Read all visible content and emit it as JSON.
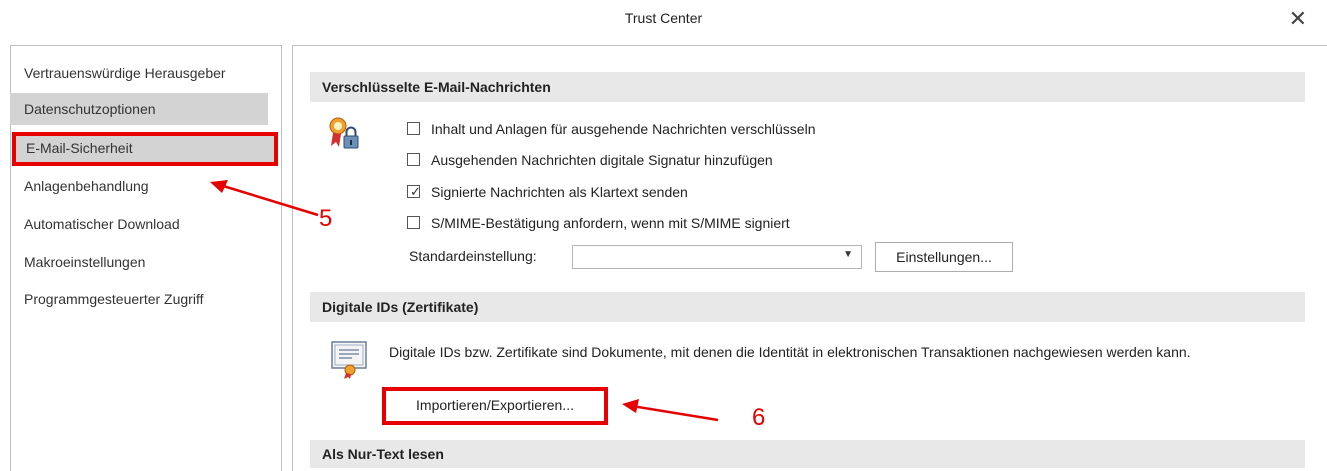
{
  "window": {
    "title": "Trust Center",
    "close_symbol": "✕"
  },
  "sidebar": {
    "items": [
      {
        "label": "Vertrauenswürdige Herausgeber"
      },
      {
        "label": "Datenschutzoptionen"
      },
      {
        "label": "E-Mail-Sicherheit"
      },
      {
        "label": "Anlagenbehandlung"
      },
      {
        "label": "Automatischer Download"
      },
      {
        "label": "Makroeinstellungen"
      },
      {
        "label": "Programmgesteuerter Zugriff"
      }
    ]
  },
  "encrypted": {
    "header": "Verschlüsselte E-Mail-Nachrichten",
    "options": [
      {
        "label": "Inhalt und Anlagen für ausgehende Nachrichten verschlüsseln",
        "checked": false
      },
      {
        "label": "Ausgehenden Nachrichten digitale Signatur hinzufügen",
        "checked": false
      },
      {
        "label": "Signierte Nachrichten als Klartext senden",
        "checked": true
      },
      {
        "label": "S/MIME-Bestätigung anfordern, wenn mit S/MIME signiert",
        "checked": false
      }
    ],
    "default_label": "Standardeinstellung:",
    "default_value": "",
    "settings_button": "Einstellungen..."
  },
  "digital_ids": {
    "header": "Digitale IDs (Zertifikate)",
    "description": "Digitale IDs bzw. Zertifikate sind Dokumente, mit denen die Identität in elektronischen Transaktionen nachgewiesen werden kann.",
    "import_button": "Importieren/Exportieren..."
  },
  "plain_text": {
    "header": "Als Nur-Text lesen"
  },
  "annotations": {
    "step5": "5",
    "step6": "6"
  },
  "colors": {
    "annotation": "#e60000",
    "selected_bg": "#d3d3d3",
    "header_bg": "#e8e8e8"
  }
}
